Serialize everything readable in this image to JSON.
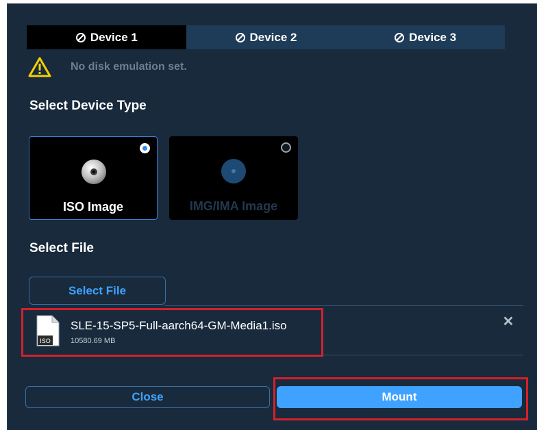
{
  "tabs": [
    {
      "label": "Device 1",
      "active": true,
      "icon": "prohibited-icon"
    },
    {
      "label": "Device 2",
      "active": false,
      "icon": "prohibited-icon"
    },
    {
      "label": "Device 3",
      "active": false,
      "icon": "prohibited-icon"
    }
  ],
  "warning": {
    "icon": "warning-triangle-icon",
    "text": "No disk emulation set."
  },
  "device_type": {
    "title": "Select Device Type",
    "options": [
      {
        "label": "ISO Image",
        "selected": true,
        "icon": "cd-disc-icon"
      },
      {
        "label": "IMG/IMA Image",
        "selected": false,
        "icon": "disk-icon"
      }
    ]
  },
  "file_section": {
    "title": "Select File",
    "button_label": "Select File",
    "file": {
      "name": "SLE-15-SP5-Full-aarch64-GM-Media1.iso",
      "size": "10580.69 MB",
      "icon_tag": "ISO"
    },
    "remove_icon": "close-icon",
    "remove_glyph": "✕"
  },
  "footer": {
    "close_label": "Close",
    "mount_label": "Mount"
  },
  "colors": {
    "background": "#182a3c",
    "accent": "#3fa2ff",
    "tab_inactive": "#1e3b57",
    "warning": "#f5d000",
    "highlight": "#d6202a"
  }
}
